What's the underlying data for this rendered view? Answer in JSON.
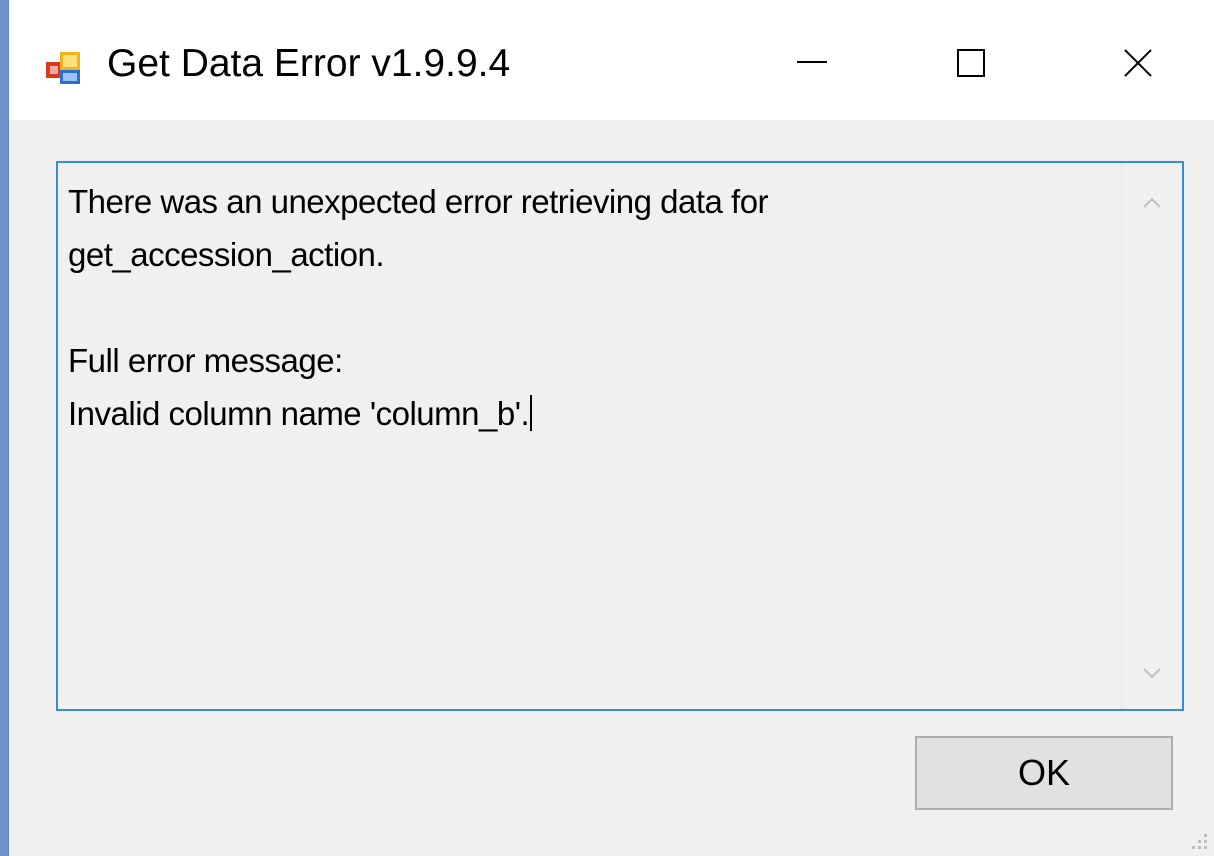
{
  "window": {
    "title": "Get Data Error v1.9.9.4",
    "caption_buttons": {
      "minimize_icon": "minimize-icon",
      "maximize_icon": "maximize-icon",
      "close_icon": "close-icon"
    }
  },
  "message": {
    "line1": "There was an unexpected error retrieving data for",
    "line2": "get_accession_action.",
    "line3": "",
    "line4": "Full error message:",
    "line5": "Invalid column name 'column_b'."
  },
  "buttons": {
    "ok_label": "OK"
  },
  "colors": {
    "accent_border": "#3a8bd6",
    "desktop_background": "#6f93c6",
    "dialog_background": "#f0f0f0"
  }
}
